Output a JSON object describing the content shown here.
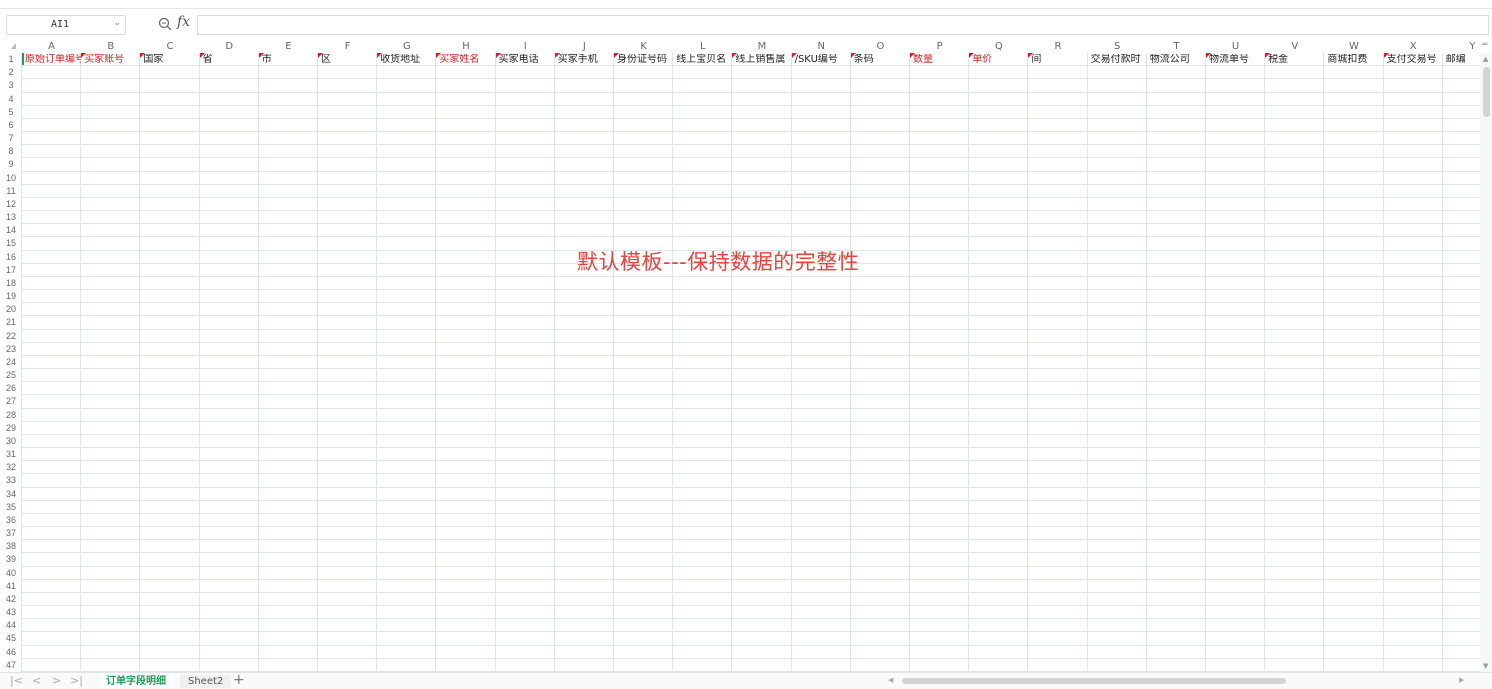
{
  "name_box": {
    "value": "AI1"
  },
  "formula_bar": {
    "fx_label": "fx",
    "value": ""
  },
  "columns": [
    "A",
    "B",
    "C",
    "D",
    "E",
    "F",
    "G",
    "H",
    "I",
    "J",
    "K",
    "L",
    "M",
    "N",
    "O",
    "P",
    "Q",
    "R",
    "S",
    "T",
    "U",
    "V",
    "W",
    "X",
    "Y"
  ],
  "rows": [
    "1",
    "2",
    "3",
    "4",
    "5",
    "6",
    "7",
    "8",
    "9",
    "10",
    "11",
    "12",
    "13",
    "14",
    "15",
    "16",
    "17",
    "18",
    "19",
    "20",
    "21",
    "22",
    "23",
    "24",
    "25",
    "26",
    "27",
    "28",
    "29",
    "30",
    "31",
    "32",
    "33",
    "34",
    "35",
    "36",
    "37",
    "38",
    "39",
    "40",
    "41",
    "42",
    "43",
    "44",
    "45",
    "46",
    "47"
  ],
  "header_row": [
    {
      "text": "原始订单编号",
      "required": true,
      "note": false
    },
    {
      "text": "买家账号",
      "required": true,
      "note": true
    },
    {
      "text": "国家",
      "required": false,
      "note": true
    },
    {
      "text": "省",
      "required": false,
      "note": true
    },
    {
      "text": "市",
      "required": false,
      "note": true
    },
    {
      "text": "区",
      "required": false,
      "note": true
    },
    {
      "text": "收货地址",
      "required": false,
      "note": true
    },
    {
      "text": "买家姓名",
      "required": true,
      "note": true
    },
    {
      "text": "买家电话",
      "required": false,
      "note": true
    },
    {
      "text": "买家手机",
      "required": false,
      "note": true
    },
    {
      "text": "身份证号码",
      "required": false,
      "note": true
    },
    {
      "text": "线上宝贝名",
      "required": false,
      "note": false
    },
    {
      "text": "线上销售属",
      "required": false,
      "note": true
    },
    {
      "text": "/SKU编号",
      "required": false,
      "note": true
    },
    {
      "text": "条码",
      "required": false,
      "note": true
    },
    {
      "text": "数量",
      "required": true,
      "note": true
    },
    {
      "text": "单价",
      "required": true,
      "note": true
    },
    {
      "text": "间",
      "required": false,
      "note": true
    },
    {
      "text": "交易付款时",
      "required": false,
      "note": false
    },
    {
      "text": "物流公司",
      "required": false,
      "note": false
    },
    {
      "text": "物流单号",
      "required": false,
      "note": true
    },
    {
      "text": "税金",
      "required": false,
      "note": true
    },
    {
      "text": "商城扣费",
      "required": false,
      "note": false
    },
    {
      "text": "支付交易号",
      "required": false,
      "note": true
    },
    {
      "text": "邮编",
      "required": false,
      "note": false
    }
  ],
  "watermark": "默认模板---保持数据的完整性",
  "sheets": [
    {
      "name": "订单字段明细",
      "active": true
    },
    {
      "name": "Sheet2",
      "active": false
    }
  ],
  "add_sheet_label": "+",
  "colors": {
    "required_text": "#e02020",
    "active_tab": "#1e9e5a",
    "watermark": "#f0403a",
    "grid": "#e0e3e8"
  }
}
